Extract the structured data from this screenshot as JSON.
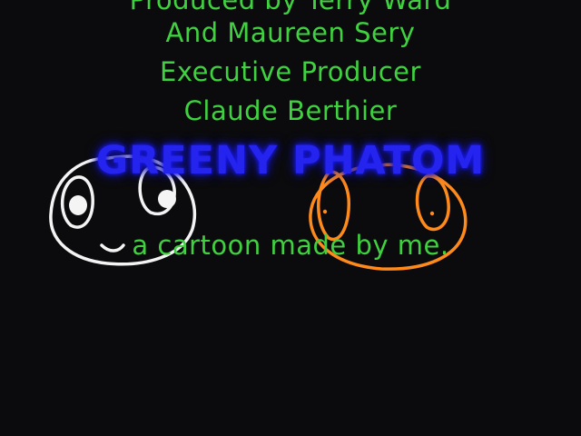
{
  "credits": {
    "line1": "Produced by Terry Ward",
    "line2": "And Maureen Sery",
    "line3": "Executive Producer",
    "line4": "Claude Berthier"
  },
  "title": "GREENY PHATOM",
  "tagline": "a cartoon made by me.",
  "colors": {
    "background": "#0b0b0d",
    "credit_text": "#3fd13f",
    "title_text": "#2424ee",
    "white_face": "#f4f4f4",
    "orange_face": "#ff8a1c"
  }
}
